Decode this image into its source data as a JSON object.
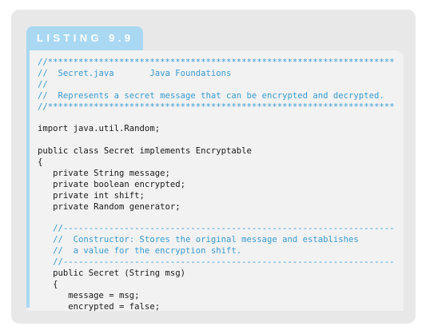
{
  "listing": {
    "label": "LISTING 9.9"
  },
  "code_lines": [
    {
      "text": "//********************************************************************",
      "kind": "comment"
    },
    {
      "text": "//  Secret.java       Java Foundations",
      "kind": "comment"
    },
    {
      "text": "//",
      "kind": "comment"
    },
    {
      "text": "//  Represents a secret message that can be encrypted and decrypted.",
      "kind": "comment"
    },
    {
      "text": "//********************************************************************",
      "kind": "comment"
    },
    {
      "text": "",
      "kind": "code"
    },
    {
      "text": "import java.util.Random;",
      "kind": "code"
    },
    {
      "text": "",
      "kind": "code"
    },
    {
      "text": "public class Secret implements Encryptable",
      "kind": "code"
    },
    {
      "text": "{",
      "kind": "code"
    },
    {
      "text": "   private String message;",
      "kind": "code"
    },
    {
      "text": "   private boolean encrypted;",
      "kind": "code"
    },
    {
      "text": "   private int shift;",
      "kind": "code"
    },
    {
      "text": "   private Random generator;",
      "kind": "code"
    },
    {
      "text": "",
      "kind": "code"
    },
    {
      "text": "   //-----------------------------------------------------------------",
      "kind": "comment"
    },
    {
      "text": "   //  Constructor: Stores the original message and establishes",
      "kind": "comment"
    },
    {
      "text": "   //  a value for the encryption shift.",
      "kind": "comment"
    },
    {
      "text": "   //-----------------------------------------------------------------",
      "kind": "comment"
    },
    {
      "text": "   public Secret (String msg)",
      "kind": "code"
    },
    {
      "text": "   {",
      "kind": "code"
    },
    {
      "text": "      message = msg;",
      "kind": "code"
    },
    {
      "text": "      encrypted = false;",
      "kind": "code"
    }
  ],
  "colors": {
    "accent": "#a9d8f2",
    "comment": "#3a9bd0",
    "code": "#1a1a1a",
    "panel": "#e8e8e8",
    "code_background": "#f2f2f2"
  }
}
